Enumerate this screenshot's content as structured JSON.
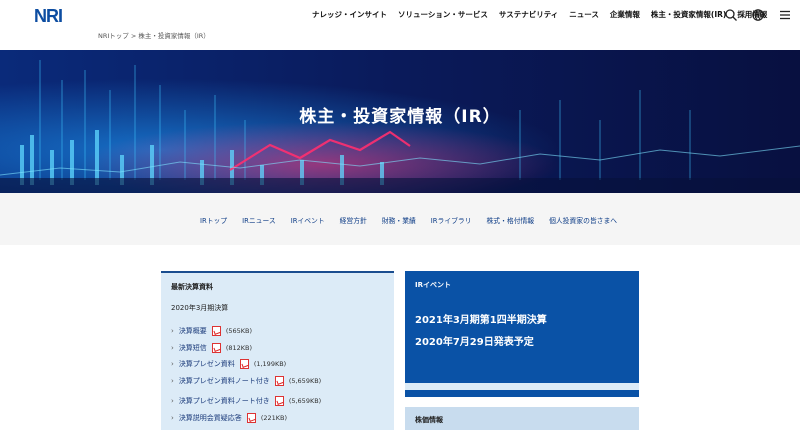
{
  "header": {
    "logo": "NRI",
    "nav": [
      "ナレッジ・インサイト",
      "ソリューション・サービス",
      "サステナビリティ",
      "ニュース",
      "企業情報",
      "株主・投資家情報(IR)",
      "採用情報"
    ],
    "icons": [
      "search-icon",
      "globe-icon",
      "menu-icon"
    ]
  },
  "breadcrumb": "NRIトップ > 株主・投資家情報（IR）",
  "hero": {
    "title": "株主・投資家情報（IR）"
  },
  "subnav": [
    "IRトップ",
    "IRニュース",
    "IRイベント",
    "経営方針",
    "財務・業績",
    "IRライブラリ",
    "株式・格付情報",
    "個人投資家の皆さまへ"
  ],
  "latest_docs": {
    "title": "最新決算資料",
    "period": "2020年3月期決算",
    "items": [
      {
        "label": "決算概要",
        "size": "(565KB)"
      },
      {
        "label": "決算短信",
        "size": "(812KB)"
      },
      {
        "label": "決算プレゼン資料",
        "size": "(1,199KB)"
      },
      {
        "label": "決算プレゼン資料ノート付き",
        "size": "(5,659KB)"
      },
      {
        "label": "決算プレゼン資料ノート付き",
        "size": "(5,659KB)"
      },
      {
        "label": "決算説明会質疑応答",
        "size": "(221KB)"
      }
    ]
  },
  "ir_event": {
    "label": "IRイベント",
    "line1": "2021年3月期第1四半期決算",
    "line2": "2020年7月29日発表予定"
  },
  "stock": {
    "label": "株価情報"
  },
  "colors": {
    "brand": "#0d4da1",
    "event_bg": "#0a52a6",
    "panel_bg": "#dcebf7",
    "hero_bg": "#07144a"
  }
}
